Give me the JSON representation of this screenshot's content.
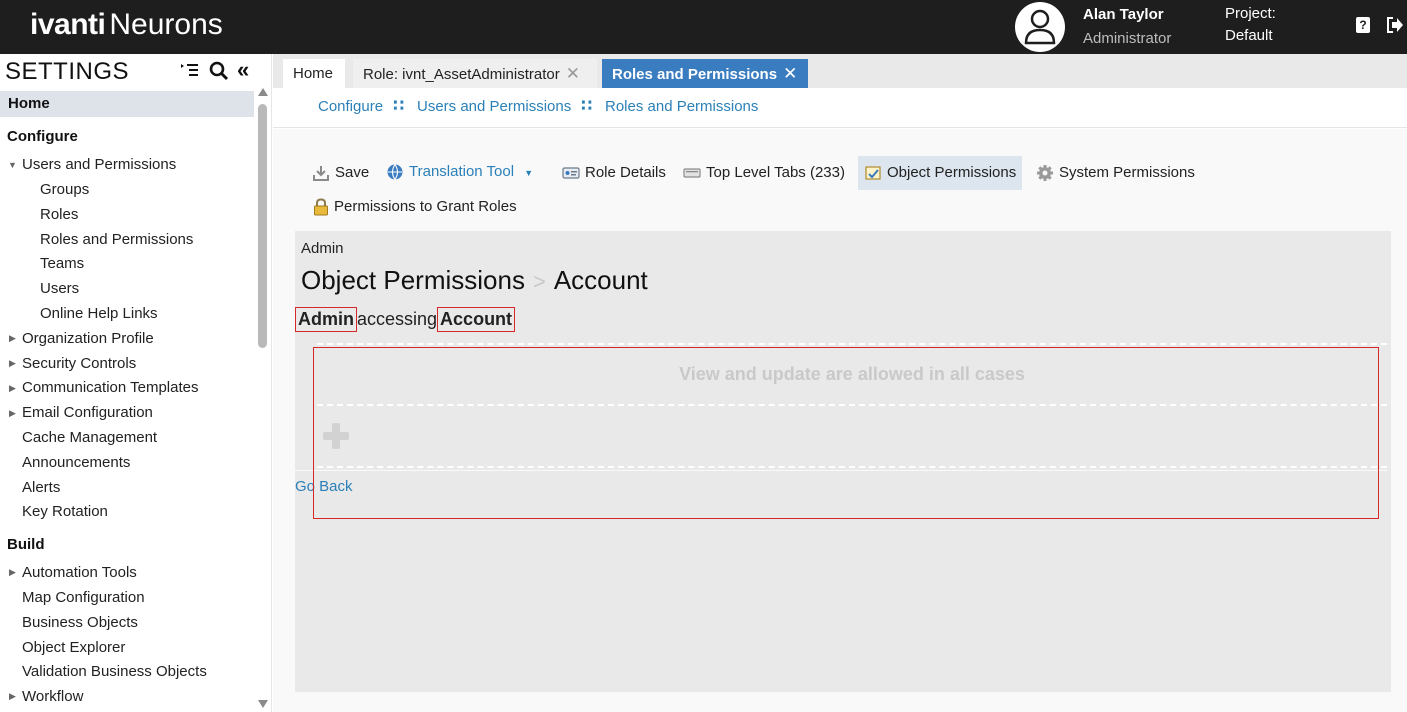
{
  "header": {
    "logo_brand": "ivanti",
    "logo_product": "Neurons",
    "user_name": "Alan Taylor",
    "user_role": "Administrator",
    "project_label": "Project:",
    "project_value": "Default",
    "help_glyph": "?"
  },
  "sidebar": {
    "title": "SETTINGS",
    "home": "Home",
    "sections": {
      "configure": "Configure",
      "build": "Build"
    },
    "items": {
      "users_and_permissions": "Users and Permissions",
      "groups": "Groups",
      "roles": "Roles",
      "roles_and_permissions": "Roles and Permissions",
      "teams": "Teams",
      "users": "Users",
      "online_help_links": "Online Help Links",
      "organization_profile": "Organization Profile",
      "security_controls": "Security Controls",
      "communication_templates": "Communication Templates",
      "email_configuration": "Email Configuration",
      "cache_management": "Cache Management",
      "announcements": "Announcements",
      "alerts": "Alerts",
      "key_rotation": "Key Rotation",
      "automation_tools": "Automation Tools",
      "map_configuration": "Map Configuration",
      "business_objects": "Business Objects",
      "object_explorer": "Object Explorer",
      "validation_business_objects": "Validation Business Objects",
      "workflow": "Workflow"
    }
  },
  "tabs": {
    "home": "Home",
    "role": "Role: ivnt_AssetAdministrator",
    "roles_and_permissions": "Roles and Permissions",
    "close_glyph": "✕"
  },
  "breadcrumb": {
    "configure": "Configure",
    "users_and_permissions": "Users and Permissions",
    "roles_and_permissions": "Roles and Permissions",
    "separator": "∷"
  },
  "toolbar": {
    "save": "Save",
    "translation_tool": "Translation Tool",
    "role_details": "Role Details",
    "top_level_tabs": "Top Level Tabs (233)",
    "object_permissions": "Object Permissions",
    "system_permissions": "System Permissions",
    "permissions_to_grant_roles": "Permissions to Grant Roles"
  },
  "panel": {
    "role_name": "Admin",
    "title": "Object Permissions",
    "title_separator": ">",
    "object_name": "Account",
    "accessing_role": "Admin",
    "accessing_word": "accessing",
    "accessing_object": "Account",
    "view_update_message": "View and update are allowed in all cases",
    "go_back": "Go Back"
  },
  "colors": {
    "topbar": "#1e1e1e",
    "accent_blue": "#3a7cc0",
    "link_blue": "#2b80b8",
    "highlight_red": "#d52828",
    "panel_gray": "#e9e9e9"
  }
}
